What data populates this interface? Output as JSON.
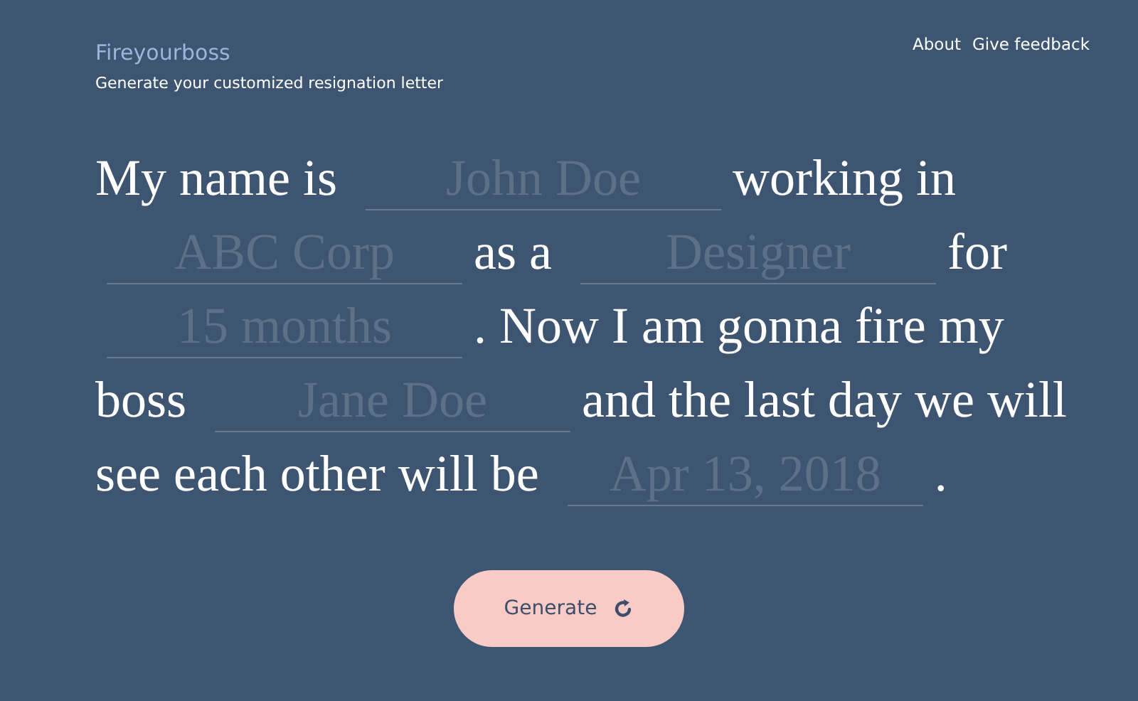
{
  "header": {
    "title": "Fireyourboss",
    "subtitle": "Generate your customized resignation letter"
  },
  "nav": [
    "About",
    "Give feedback"
  ],
  "sentence": [
    {
      "kind": "text",
      "text": "My name is"
    },
    {
      "kind": "field",
      "placeholder": "John Doe"
    },
    {
      "kind": "text",
      "text": "working in"
    },
    {
      "kind": "field",
      "placeholder": "ABC Corp"
    },
    {
      "kind": "text",
      "text": "as a"
    },
    {
      "kind": "field",
      "placeholder": "Designer"
    },
    {
      "kind": "text",
      "text": "for"
    },
    {
      "kind": "field",
      "placeholder": "15 months"
    },
    {
      "kind": "text",
      "text": ". Now I am gonna fire my"
    },
    {
      "kind": "text",
      "text": "boss"
    },
    {
      "kind": "field",
      "placeholder": "Jane Doe"
    },
    {
      "kind": "text",
      "text": "and the last day we will"
    },
    {
      "kind": "text",
      "text": "see each other will be"
    },
    {
      "kind": "field",
      "placeholder": "Apr 13, 2018"
    },
    {
      "kind": "text",
      "text": "."
    }
  ],
  "button": {
    "label": "Generate"
  }
}
